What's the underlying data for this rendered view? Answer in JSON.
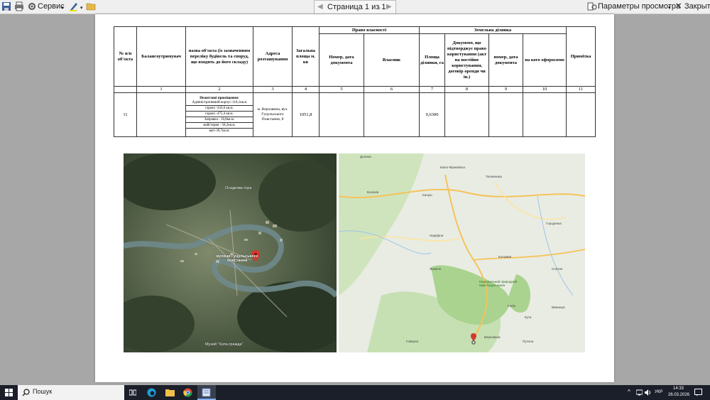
{
  "toolbar": {
    "service_label": "Сервис",
    "page_indicator": "Страница 1 из 1",
    "view_params_label": "Параметры просмотра",
    "close_label": "Закрыть"
  },
  "table": {
    "headers": {
      "num": "№ п/п об'єкта",
      "holder": "Балансоутримувач",
      "name": "назва об'єкта (із зазначенням переліку будівель та споруд, що входять до його складу)",
      "address": "Адреса розташування",
      "area": "Загальна площа м. кв",
      "ownership": "Право власності",
      "own_num_date": "Номер, дата документа",
      "owner": "Власник",
      "land": "Земельна ділянка",
      "land_area": "Площа ділянки, га",
      "land_doc": "Документ, що підтверджує право користування (акт на постійне користування, договір оренди чи ін.)",
      "land_num_date": "номер, дата документа",
      "land_whom": "на кого оформлено",
      "note": "Примітка"
    },
    "col_numbers": [
      "1",
      "2",
      "3",
      "4",
      "5",
      "6",
      "7",
      "8",
      "9",
      "10",
      "11"
    ],
    "row": {
      "num": "11",
      "name_title": "Нежитлові приміщення:",
      "name_lines": [
        "Адміністративний корпус-118,1кв.м",
        "гаражі -343,6 кв.м.",
        "гаражі -475,4 кв.м.",
        "Заправка - 16,8кв.м.",
        "майстерня - 58,2кв.м.",
        "вагі-39,7кв.м."
      ],
      "address": "м. Верховина, вул. Гуцульського Повстання, 8",
      "area": "1051,8",
      "land_area": "0,6300"
    }
  },
  "satellite": {
    "street_label": "вулиця Гуцульського повстання",
    "museum_label": "Музей \"Хата-гражда\"",
    "hill_label": "Осадкова гора"
  },
  "map": {
    "labels": [
      "Івано-Франківськ",
      "Коломия",
      "Надвірна",
      "Косів",
      "Верховина",
      "Яремче",
      "Національний природний парк Гуцульщина",
      "Говерла",
      "Болехів",
      "Калуш",
      "Долина",
      "Тисмениця",
      "Городенка",
      "Снятин",
      "Вижниця",
      "Путила",
      "Кути"
    ]
  },
  "taskbar": {
    "search_label": "Пошук",
    "lang": "УКР",
    "time": "14:33",
    "date": "26.03.2026"
  },
  "colors": {
    "page_background": "#a7a7a7",
    "taskbar": "#1b1f2a"
  }
}
